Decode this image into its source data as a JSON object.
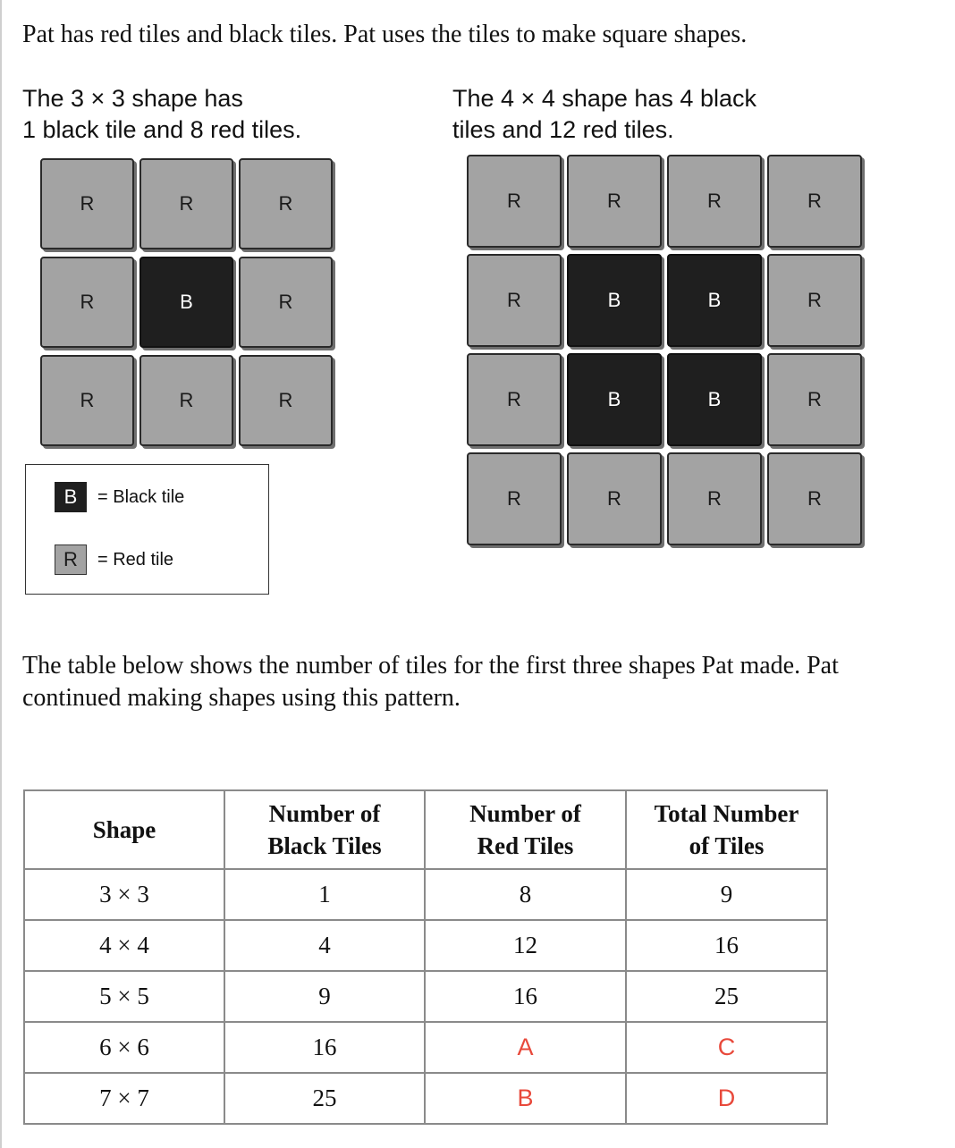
{
  "intro": "Pat has red tiles and black tiles. Pat uses the tiles to make square shapes.",
  "shape3": {
    "caption": [
      "The 3 × 3 shape has",
      "1 black tile and 8 red tiles."
    ],
    "rows": [
      [
        "R",
        "R",
        "R"
      ],
      [
        "R",
        "B",
        "R"
      ],
      [
        "R",
        "R",
        "R"
      ]
    ]
  },
  "shape4": {
    "caption": [
      "The 4 × 4 shape has 4 black",
      "tiles and 12 red tiles."
    ],
    "rows": [
      [
        "R",
        "R",
        "R",
        "R"
      ],
      [
        "R",
        "B",
        "B",
        "R"
      ],
      [
        "R",
        "B",
        "B",
        "R"
      ],
      [
        "R",
        "R",
        "R",
        "R"
      ]
    ]
  },
  "legend": {
    "black_symbol": "B",
    "black_label": "= Black tile",
    "red_symbol": "R",
    "red_label": "= Red tile"
  },
  "paragraph": "The table below shows the number of tiles for the first three shapes Pat made. Pat continued making shapes using this pattern.",
  "table": {
    "headers": [
      [
        "Shape"
      ],
      [
        "Number of",
        "Black Tiles"
      ],
      [
        "Number of",
        "Red Tiles"
      ],
      [
        "Total Number",
        "of Tiles"
      ]
    ],
    "rows": [
      [
        "3 × 3",
        "1",
        "8",
        "9"
      ],
      [
        "4 × 4",
        "4",
        "12",
        "16"
      ],
      [
        "5 × 5",
        "9",
        "16",
        "25"
      ],
      [
        "6 × 6",
        "16",
        "A",
        "C"
      ],
      [
        "7 × 7",
        "25",
        "B",
        "D"
      ]
    ],
    "answer_color": "#e8493b"
  }
}
